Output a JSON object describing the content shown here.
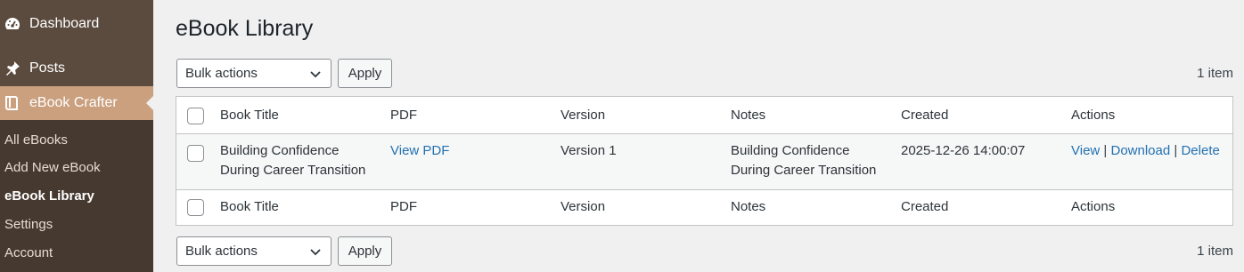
{
  "sidebar": {
    "dashboard": "Dashboard",
    "posts": "Posts",
    "ebook_crafter": "eBook Crafter",
    "submenu": [
      "All eBooks",
      "Add New eBook",
      "eBook Library",
      "Settings",
      "Account"
    ]
  },
  "page_title": "eBook Library",
  "top_nav": {
    "bulk_actions": "Bulk actions",
    "apply": "Apply",
    "count": "1 item"
  },
  "bottom_nav": {
    "bulk_actions": "Bulk actions",
    "apply": "Apply",
    "count": "1 item"
  },
  "columns": [
    "Book Title",
    "PDF",
    "Version",
    "Notes",
    "Created",
    "Actions"
  ],
  "rows": [
    {
      "title_line1": "Building Confidence",
      "title_line2": "During Career Transition",
      "pdf": "View PDF",
      "version": "Version 1",
      "notes_line1": "Building Confidence",
      "notes_line2": "During Career Transition",
      "created": "2025-12-26 14:00:07",
      "actions": {
        "view": "View",
        "download": "Download",
        "delete": "Delete",
        "sep": "|"
      }
    }
  ],
  "colors": {
    "sidebar": "#5b4a3e",
    "submenu": "#463a30",
    "active": "#caa07f",
    "link": "#2271b1"
  },
  "icons": [
    "dashboard-icon",
    "pin-icon",
    "book-icon",
    "chevron-down-icon"
  ]
}
